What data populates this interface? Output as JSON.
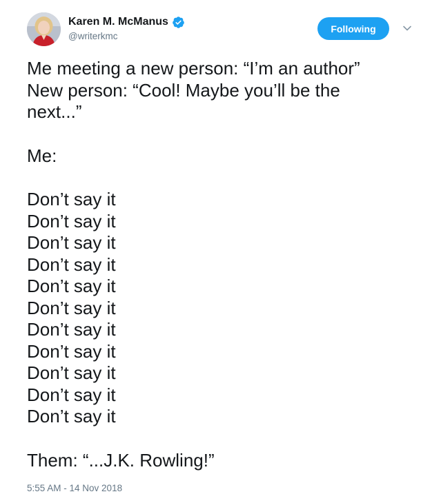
{
  "author": {
    "name": "Karen M. McManus",
    "handle": "@writerkmc",
    "verified": true,
    "avatar_icon": "author-avatar"
  },
  "follow_button": {
    "label": "Following",
    "color": "#1da1f2"
  },
  "menu": {
    "caret_icon": "chevron-down-icon"
  },
  "tweet": {
    "lines": [
      "Me meeting a new person: “I’m an author”",
      "New person: “Cool! Maybe you’ll be the",
      "next...”",
      "",
      "Me:",
      "",
      "Don’t say it",
      "Don’t say it",
      "Don’t say it",
      "Don’t say it",
      "Don’t say it",
      "Don’t say it",
      "Don’t say it",
      "Don’t say it",
      "Don’t say it",
      "Don’t say it",
      "Don’t say it",
      "",
      "Them: “...J.K. Rowling!”"
    ]
  },
  "timestamp": "5:55 AM - 14 Nov 2018",
  "colors": {
    "text": "#14171a",
    "secondary": "#657786",
    "accent": "#1da1f2"
  }
}
